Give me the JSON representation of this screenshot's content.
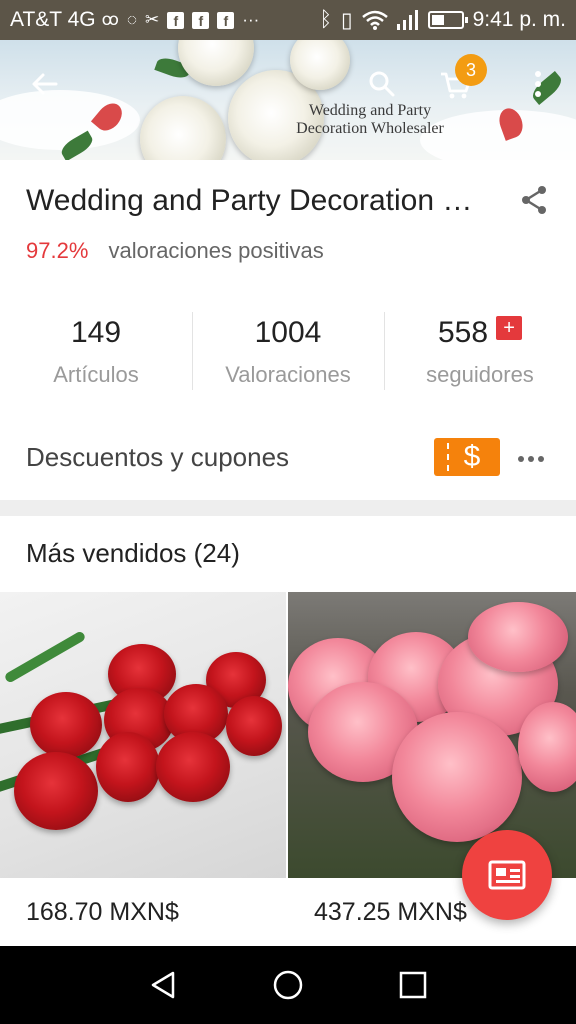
{
  "status_bar": {
    "carrier": "AT&T 4G",
    "time": "9:41 p. m.",
    "icons": [
      "voicemail-icon",
      "chat-icon",
      "scissors-icon",
      "facebook-icon",
      "facebook-icon",
      "facebook-icon",
      "more-notifications-icon",
      "bluetooth-icon",
      "vibrate-icon",
      "wifi-icon",
      "signal-icon",
      "battery-icon"
    ]
  },
  "header": {
    "brand_line1": "Wedding and Party",
    "brand_line2": "Decoration Wholesaler",
    "cart_count": "3",
    "icons": [
      "back-arrow-icon",
      "search-icon",
      "cart-icon",
      "overflow-menu-icon"
    ]
  },
  "store": {
    "name": "Wedding and Party Decoration Wholesaler",
    "positive_pct": "97.2%",
    "positive_label": "valoraciones positivas",
    "stats": [
      {
        "value": "149",
        "label": "Artículos"
      },
      {
        "value": "1004",
        "label": "Valoraciones"
      },
      {
        "value": "558",
        "label": "seguidores"
      }
    ],
    "follow_symbol": "+",
    "coupons_label": "Descuentos y cupones",
    "coupon_symbol": "$"
  },
  "best_sellers": {
    "title": "Más vendidos (24)",
    "products": [
      {
        "price": "168.70 MXN$",
        "image": "red-roses-image"
      },
      {
        "price": "437.25 MXN$",
        "image": "pink-roses-image"
      }
    ]
  },
  "colors": {
    "accent_red": "#e4393c",
    "coupon_orange": "#f5820c",
    "cart_badge": "#f39c12",
    "status_bar": "#5c5548",
    "fab": "#ef4240"
  },
  "nav_bar": {
    "icons": [
      "back-triangle-icon",
      "home-circle-icon",
      "recents-square-icon"
    ]
  }
}
